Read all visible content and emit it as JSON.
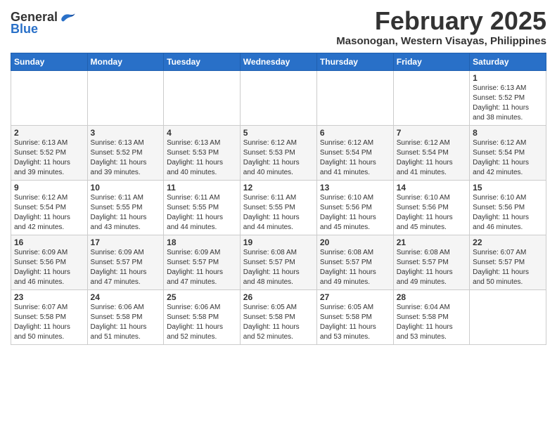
{
  "header": {
    "logo": {
      "general": "General",
      "blue": "Blue"
    },
    "title": "February 2025",
    "subtitle": "Masonogan, Western Visayas, Philippines"
  },
  "weekdays": [
    "Sunday",
    "Monday",
    "Tuesday",
    "Wednesday",
    "Thursday",
    "Friday",
    "Saturday"
  ],
  "weeks": [
    [
      {
        "day": "",
        "info": ""
      },
      {
        "day": "",
        "info": ""
      },
      {
        "day": "",
        "info": ""
      },
      {
        "day": "",
        "info": ""
      },
      {
        "day": "",
        "info": ""
      },
      {
        "day": "",
        "info": ""
      },
      {
        "day": "1",
        "info": "Sunrise: 6:13 AM\nSunset: 5:52 PM\nDaylight: 11 hours\nand 38 minutes."
      }
    ],
    [
      {
        "day": "2",
        "info": "Sunrise: 6:13 AM\nSunset: 5:52 PM\nDaylight: 11 hours\nand 39 minutes."
      },
      {
        "day": "3",
        "info": "Sunrise: 6:13 AM\nSunset: 5:52 PM\nDaylight: 11 hours\nand 39 minutes."
      },
      {
        "day": "4",
        "info": "Sunrise: 6:13 AM\nSunset: 5:53 PM\nDaylight: 11 hours\nand 40 minutes."
      },
      {
        "day": "5",
        "info": "Sunrise: 6:12 AM\nSunset: 5:53 PM\nDaylight: 11 hours\nand 40 minutes."
      },
      {
        "day": "6",
        "info": "Sunrise: 6:12 AM\nSunset: 5:54 PM\nDaylight: 11 hours\nand 41 minutes."
      },
      {
        "day": "7",
        "info": "Sunrise: 6:12 AM\nSunset: 5:54 PM\nDaylight: 11 hours\nand 41 minutes."
      },
      {
        "day": "8",
        "info": "Sunrise: 6:12 AM\nSunset: 5:54 PM\nDaylight: 11 hours\nand 42 minutes."
      }
    ],
    [
      {
        "day": "9",
        "info": "Sunrise: 6:12 AM\nSunset: 5:54 PM\nDaylight: 11 hours\nand 42 minutes."
      },
      {
        "day": "10",
        "info": "Sunrise: 6:11 AM\nSunset: 5:55 PM\nDaylight: 11 hours\nand 43 minutes."
      },
      {
        "day": "11",
        "info": "Sunrise: 6:11 AM\nSunset: 5:55 PM\nDaylight: 11 hours\nand 44 minutes."
      },
      {
        "day": "12",
        "info": "Sunrise: 6:11 AM\nSunset: 5:55 PM\nDaylight: 11 hours\nand 44 minutes."
      },
      {
        "day": "13",
        "info": "Sunrise: 6:10 AM\nSunset: 5:56 PM\nDaylight: 11 hours\nand 45 minutes."
      },
      {
        "day": "14",
        "info": "Sunrise: 6:10 AM\nSunset: 5:56 PM\nDaylight: 11 hours\nand 45 minutes."
      },
      {
        "day": "15",
        "info": "Sunrise: 6:10 AM\nSunset: 5:56 PM\nDaylight: 11 hours\nand 46 minutes."
      }
    ],
    [
      {
        "day": "16",
        "info": "Sunrise: 6:09 AM\nSunset: 5:56 PM\nDaylight: 11 hours\nand 46 minutes."
      },
      {
        "day": "17",
        "info": "Sunrise: 6:09 AM\nSunset: 5:57 PM\nDaylight: 11 hours\nand 47 minutes."
      },
      {
        "day": "18",
        "info": "Sunrise: 6:09 AM\nSunset: 5:57 PM\nDaylight: 11 hours\nand 47 minutes."
      },
      {
        "day": "19",
        "info": "Sunrise: 6:08 AM\nSunset: 5:57 PM\nDaylight: 11 hours\nand 48 minutes."
      },
      {
        "day": "20",
        "info": "Sunrise: 6:08 AM\nSunset: 5:57 PM\nDaylight: 11 hours\nand 49 minutes."
      },
      {
        "day": "21",
        "info": "Sunrise: 6:08 AM\nSunset: 5:57 PM\nDaylight: 11 hours\nand 49 minutes."
      },
      {
        "day": "22",
        "info": "Sunrise: 6:07 AM\nSunset: 5:57 PM\nDaylight: 11 hours\nand 50 minutes."
      }
    ],
    [
      {
        "day": "23",
        "info": "Sunrise: 6:07 AM\nSunset: 5:58 PM\nDaylight: 11 hours\nand 50 minutes."
      },
      {
        "day": "24",
        "info": "Sunrise: 6:06 AM\nSunset: 5:58 PM\nDaylight: 11 hours\nand 51 minutes."
      },
      {
        "day": "25",
        "info": "Sunrise: 6:06 AM\nSunset: 5:58 PM\nDaylight: 11 hours\nand 52 minutes."
      },
      {
        "day": "26",
        "info": "Sunrise: 6:05 AM\nSunset: 5:58 PM\nDaylight: 11 hours\nand 52 minutes."
      },
      {
        "day": "27",
        "info": "Sunrise: 6:05 AM\nSunset: 5:58 PM\nDaylight: 11 hours\nand 53 minutes."
      },
      {
        "day": "28",
        "info": "Sunrise: 6:04 AM\nSunset: 5:58 PM\nDaylight: 11 hours\nand 53 minutes."
      },
      {
        "day": "",
        "info": ""
      }
    ]
  ]
}
